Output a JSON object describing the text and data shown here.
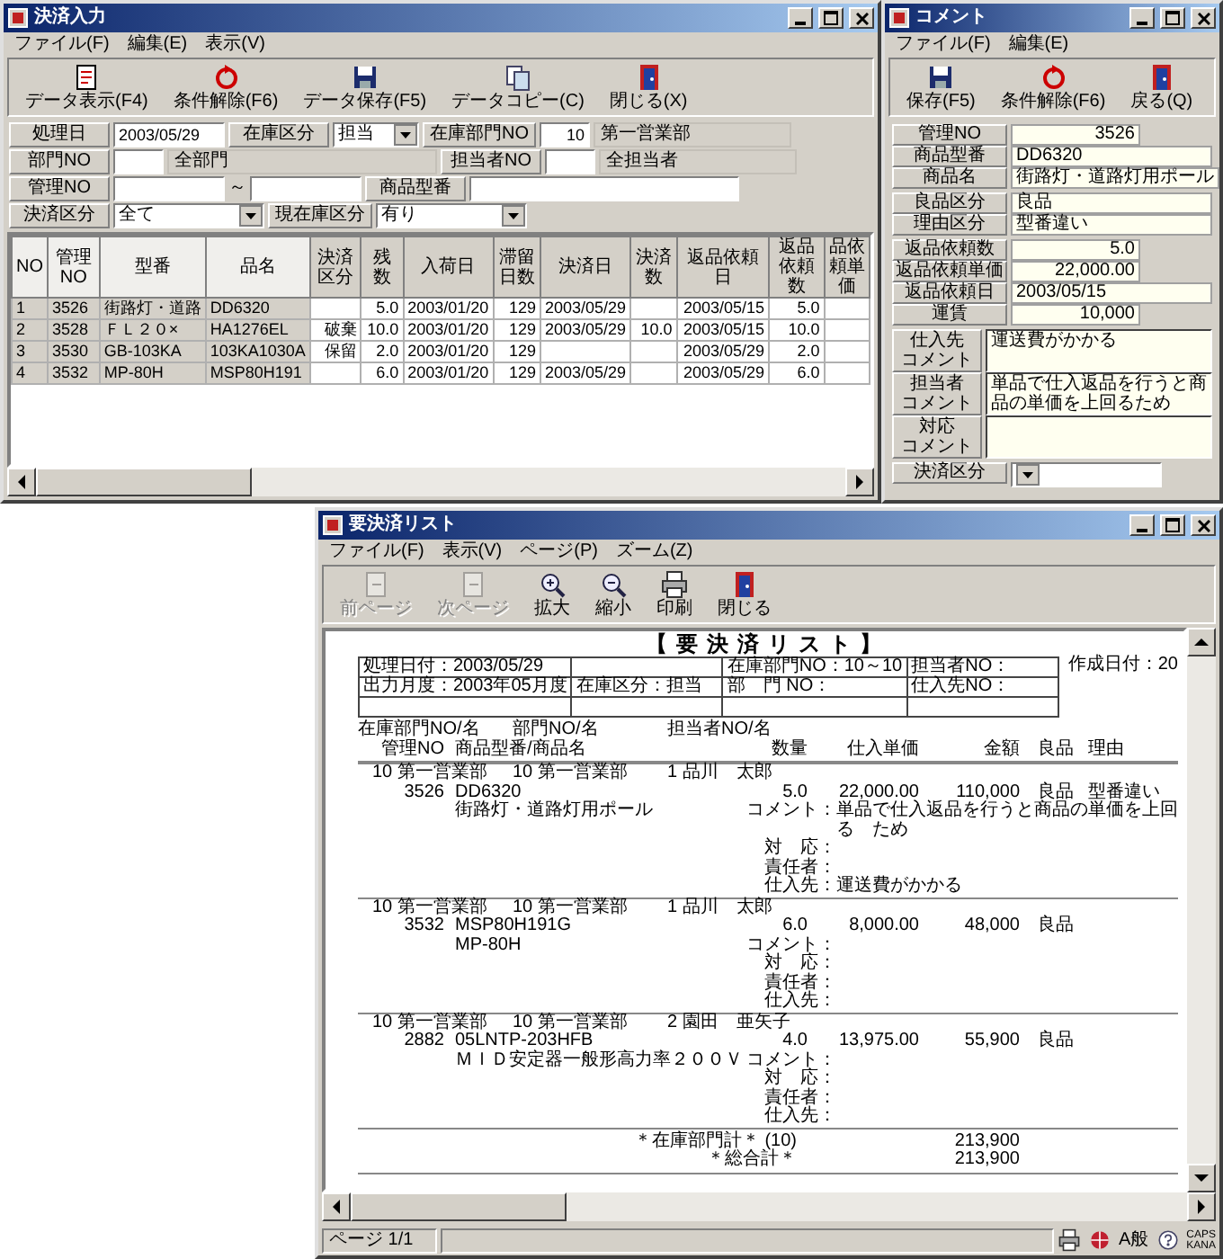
{
  "input_window": {
    "title": "決済入力",
    "menu": [
      "ファイル(F)",
      "編集(E)",
      "表示(V)"
    ],
    "toolbar": [
      {
        "label": "データ表示(F4)",
        "kind": "query"
      },
      {
        "label": "条件解除(F6)",
        "kind": "reset"
      },
      {
        "label": "データ保存(F5)",
        "kind": "save"
      },
      {
        "label": "データコピー(C)",
        "kind": "copy"
      },
      {
        "label": "閉じる(X)",
        "kind": "close"
      }
    ],
    "form": {
      "processing_date": {
        "label": "処理日",
        "value": "2003/05/29"
      },
      "stock_type": {
        "label": "在庫区分",
        "value": "担当"
      },
      "stock_dept": {
        "label": "在庫部門NO",
        "value": "10",
        "name": "第一営業部"
      },
      "dept": {
        "label": "部門NO",
        "name": "全部門"
      },
      "staff": {
        "label": "担当者NO",
        "name": "全担当者"
      },
      "control_no": {
        "label": "管理NO",
        "separator": "～"
      },
      "model": {
        "label": "商品型番"
      },
      "settlement_type": {
        "label": "決済区分",
        "value": "全て"
      },
      "current_stock": {
        "label": "現在庫区分",
        "value": "有り"
      }
    },
    "table": {
      "columns": [
        {
          "label": "NO",
          "frozen": true
        },
        {
          "label": "管理NO",
          "frozen": true
        },
        {
          "label": "型番",
          "frozen": true
        },
        {
          "label": "品名",
          "frozen": true
        },
        {
          "label": "決済区分",
          "frozen": false
        },
        {
          "label": "残数",
          "frozen": false
        },
        {
          "label": "入荷日",
          "frozen": false
        },
        {
          "label": "滞留日数",
          "frozen": false
        },
        {
          "label": "決済日",
          "frozen": false
        },
        {
          "label": "決済数",
          "frozen": false
        },
        {
          "label": "返品依頼日",
          "frozen": false
        },
        {
          "label": "返品依頼数",
          "frozen": false
        },
        {
          "label": "品依頼単価",
          "frozen": false
        }
      ],
      "rows": [
        [
          "1",
          "3526",
          "街路灯・道路",
          "DD6320",
          null,
          "5.0",
          "2003/01/20",
          "129",
          "2003/05/29",
          null,
          "2003/05/15",
          "5.0",
          null
        ],
        [
          "2",
          "3528",
          "ＦＬ２０×",
          "HA1276EL",
          "破棄",
          "10.0",
          "2003/01/20",
          "129",
          "2003/05/29",
          "10.0",
          "2003/05/15",
          "10.0",
          null
        ],
        [
          "3",
          "3530",
          "GB-103KA",
          "103KA1030A",
          "保留",
          "2.0",
          "2003/01/20",
          "129",
          null,
          null,
          "2003/05/29",
          "2.0",
          null
        ],
        [
          "4",
          "3532",
          "MP-80H",
          "MSP80H191",
          null,
          "6.0",
          "2003/01/20",
          "129",
          "2003/05/29",
          null,
          "2003/05/29",
          "6.0",
          null
        ]
      ]
    }
  },
  "comment_window": {
    "title": "コメント",
    "menu": [
      "ファイル(F)",
      "編集(E)"
    ],
    "toolbar": [
      {
        "label": "保存(F5)",
        "kind": "save"
      },
      {
        "label": "条件解除(F6)",
        "kind": "reset"
      },
      {
        "label": "戻る(Q)",
        "kind": "close"
      }
    ],
    "field_groups": [
      [
        {
          "label": "管理NO",
          "value": "3526",
          "kind": "number"
        },
        {
          "label": "商品型番",
          "value": "DD6320",
          "kind": "text"
        },
        {
          "label": "商品名",
          "value": "街路灯・道路灯用ポール",
          "kind": "text"
        }
      ],
      [
        {
          "label": "良品区分",
          "value": "良品",
          "kind": "text"
        },
        {
          "label": "理由区分",
          "value": "型番違い",
          "kind": "text"
        }
      ],
      [
        {
          "label": "返品依頼数",
          "value": "5.0",
          "kind": "number"
        },
        {
          "label": "返品依頼単価",
          "value": "22,000.00",
          "kind": "number"
        },
        {
          "label": "返品依頼日",
          "value": "2003/05/15",
          "kind": "text"
        },
        {
          "label": "運賃",
          "value": "10,000",
          "kind": "number"
        }
      ]
    ],
    "comments": [
      {
        "label_lines": [
          "仕入先",
          "コメント"
        ],
        "value": "運送費がかかる"
      },
      {
        "label_lines": [
          "担当者",
          "コメント"
        ],
        "value": "単品で仕入返品を行うと商品の単価を上回るため"
      },
      {
        "label_lines": [
          "対応",
          "コメント"
        ]
      }
    ],
    "settlement": {
      "label": "決済区分"
    }
  },
  "report_window": {
    "title": "要決済リスト",
    "menu": [
      "ファイル(F)",
      "表示(V)",
      "ページ(P)",
      "ズーム(Z)"
    ],
    "toolbar": [
      {
        "label": "前ページ",
        "kind": "page",
        "disabled": true
      },
      {
        "label": "次ページ",
        "kind": "page",
        "disabled": true
      },
      {
        "label": "拡大",
        "kind": "zoomin",
        "disabled": false
      },
      {
        "label": "縮小",
        "kind": "zoomout",
        "disabled": false
      },
      {
        "label": "印刷",
        "kind": "print",
        "disabled": false
      },
      {
        "label": "閉じる",
        "kind": "close",
        "disabled": false
      }
    ],
    "report": {
      "title": "【要決済リスト】",
      "created": "作成日付：20",
      "header_box": [
        {
          "column_1": "処理日付：2003/05/29",
          "column_3": "在庫部門NO：10～10",
          "column_4": "担当者NO："
        },
        {
          "column_1": "出力月度：2003年05月度",
          "column_2": "在庫区分：担当",
          "column_3": "部　門 NO：",
          "column_4": "仕入先NO："
        }
      ],
      "column_headers": {
        "stock_dept": "在庫部門NO/名",
        "dept": "部門NO/名",
        "staff": "担当者NO/名",
        "control_no": "管理NO",
        "model": "商品型番/商品名",
        "qty": "数量",
        "unit_price": "仕入単価",
        "amount": "金額",
        "quality": "良品",
        "reason": "理由"
      },
      "records": [
        {
          "stock_dept": "10 第一営業部",
          "dept": "10 第一営業部",
          "staff": "1 品川　太郎",
          "control_no": "3526",
          "model": "DD6320",
          "name": "街路灯・道路灯用ポール",
          "qty": "5.0",
          "unit_price": "22,000.00",
          "amount": "110,000",
          "quality": "良品",
          "reason": "型番違い",
          "notes": [
            {
              "label": "コメント：",
              "value": "単品で仕入返品を行うと商品の単価を上回る　ため"
            },
            {
              "label": "対　応："
            },
            {
              "label": "責任者："
            },
            {
              "label": "仕入先：",
              "value": "運送費がかかる"
            }
          ]
        },
        {
          "stock_dept": "10 第一営業部",
          "dept": "10 第一営業部",
          "staff": "1 品川　太郎",
          "control_no": "3532",
          "model": "MSP80H191G",
          "name": "MP-80H",
          "qty": "6.0",
          "unit_price": "8,000.00",
          "amount": "48,000",
          "quality": "良品",
          "notes": [
            {
              "label": "コメント："
            },
            {
              "label": "対　応："
            },
            {
              "label": "責任者："
            },
            {
              "label": "仕入先："
            }
          ]
        },
        {
          "stock_dept": "10 第一営業部",
          "dept": "10 第一営業部",
          "staff": "2 園田　亜矢子",
          "control_no": "2882",
          "model": "05LNTP-203HFB",
          "name": "ＭＩＤ安定器一般形高力率２００Ｖ",
          "qty": "4.0",
          "unit_price": "13,975.00",
          "amount": "55,900",
          "quality": "良品",
          "notes": [
            {
              "label": "コメント："
            },
            {
              "label": "対　応："
            },
            {
              "label": "責任者："
            },
            {
              "label": "仕入先："
            }
          ]
        }
      ],
      "totals": [
        {
          "label": "＊在庫部門計＊ (10)",
          "value": "213,900"
        },
        {
          "label": "＊総合計＊",
          "value": "213,900"
        }
      ]
    },
    "status_bar": {
      "page": "ページ 1/1",
      "ime": "A般",
      "keys": [
        "CAPS",
        "KANA"
      ]
    }
  }
}
